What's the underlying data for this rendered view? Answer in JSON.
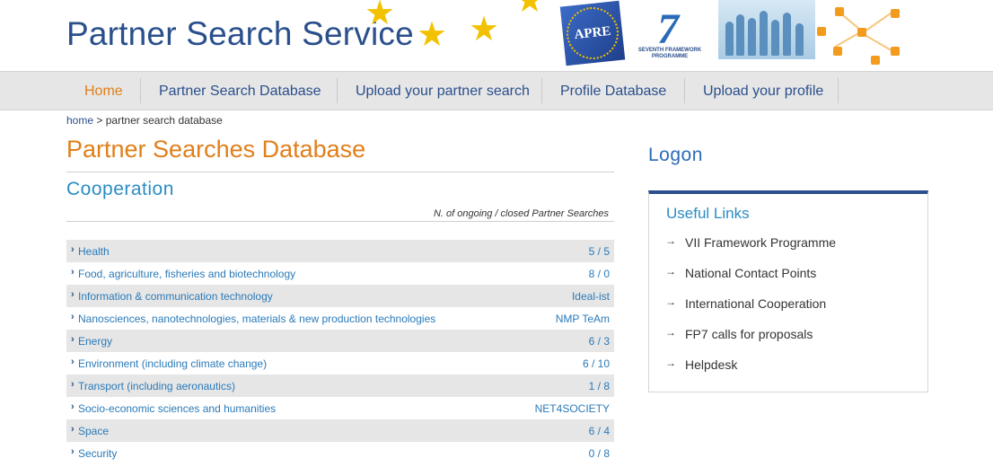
{
  "header": {
    "site_title": "Partner Search Service",
    "logos": {
      "apre": "APRE",
      "fp7_mark": "7",
      "fp7_caption": "SEVENTH FRAMEWORK PROGRAMME"
    },
    "accent_color": "#f2c200",
    "icons": [
      "star-icon",
      "apre-logo",
      "fp7-logo",
      "people-image",
      "network-image"
    ]
  },
  "nav": {
    "items": [
      {
        "label": "Home",
        "active": true
      },
      {
        "label": "Partner Search Database",
        "active": false
      },
      {
        "label": "Upload your partner search",
        "active": false
      },
      {
        "label": "Profile Database",
        "active": false
      },
      {
        "label": "Upload your profile",
        "active": false
      }
    ]
  },
  "breadcrumb": {
    "home": "home",
    "separator": ">",
    "current": "partner search database"
  },
  "main": {
    "page_title": "Partner Searches Database",
    "section_title": "Cooperation",
    "count_header": "N. of ongoing / closed Partner Searches",
    "rows": [
      {
        "name": "Health",
        "value": "5 / 5"
      },
      {
        "name": "Food, agriculture, fisheries and biotechnology",
        "value": "8 / 0"
      },
      {
        "name": "Information & communication technology",
        "value": "Ideal-ist"
      },
      {
        "name": "Nanosciences, nanotechnologies, materials & new production technologies",
        "value": "NMP TeAm"
      },
      {
        "name": "Energy",
        "value": "6 / 3"
      },
      {
        "name": "Environment (including climate change)",
        "value": "6 / 10"
      },
      {
        "name": "Transport (including aeronautics)",
        "value": "1 / 8"
      },
      {
        "name": "Socio-economic sciences and humanities",
        "value": "NET4SOCIETY"
      },
      {
        "name": "Space",
        "value": "6 / 4"
      },
      {
        "name": "Security",
        "value": "0 / 8"
      }
    ]
  },
  "sidebar": {
    "logon_title": "Logon",
    "useful_links_title": "Useful Links",
    "links": [
      "VII Framework Programme",
      "National Contact Points",
      "International Cooperation",
      "FP7 calls for proposals",
      "Helpdesk"
    ]
  },
  "colors": {
    "brand_blue": "#2a4f8c",
    "accent_orange": "#e07f1a",
    "link_blue": "#2a7ab8"
  }
}
